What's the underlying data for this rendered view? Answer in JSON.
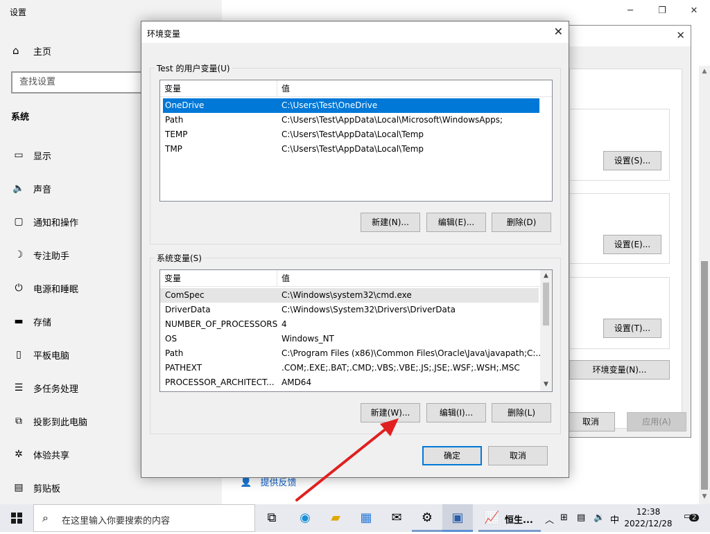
{
  "settings": {
    "title": "设置",
    "home": "主页",
    "search_placeholder": "查找设置",
    "section": "系统",
    "nav": [
      {
        "label": "显示",
        "icon": "monitor-icon"
      },
      {
        "label": "声音",
        "icon": "speaker-icon"
      },
      {
        "label": "通知和操作",
        "icon": "notification-icon"
      },
      {
        "label": "专注助手",
        "icon": "moon-icon"
      },
      {
        "label": "电源和睡眠",
        "icon": "power-icon"
      },
      {
        "label": "存储",
        "icon": "storage-icon"
      },
      {
        "label": "平板电脑",
        "icon": "tablet-icon"
      },
      {
        "label": "多任务处理",
        "icon": "multitask-icon"
      },
      {
        "label": "投影到此电脑",
        "icon": "project-icon"
      },
      {
        "label": "体验共享",
        "icon": "share-icon"
      },
      {
        "label": "剪贴板",
        "icon": "clipboard-icon"
      }
    ],
    "feedback": "提供反馈"
  },
  "sysprop": {
    "btn_perf": "设置(S)...",
    "btn_profile": "设置(E)...",
    "btn_startup": "设置(T)...",
    "btn_env": "环境变量(N)...",
    "btn_cancel": "取消",
    "btn_apply": "应用(A)"
  },
  "env_dialog": {
    "title": "环境变量",
    "user_group": "Test 的用户变量(U)",
    "system_group": "系统变量(S)",
    "col_var": "变量",
    "col_val": "值",
    "user_vars": [
      {
        "name": "OneDrive",
        "value": "C:\\Users\\Test\\OneDrive"
      },
      {
        "name": "Path",
        "value": "C:\\Users\\Test\\AppData\\Local\\Microsoft\\WindowsApps;"
      },
      {
        "name": "TEMP",
        "value": "C:\\Users\\Test\\AppData\\Local\\Temp"
      },
      {
        "name": "TMP",
        "value": "C:\\Users\\Test\\AppData\\Local\\Temp"
      }
    ],
    "system_vars": [
      {
        "name": "ComSpec",
        "value": "C:\\Windows\\system32\\cmd.exe"
      },
      {
        "name": "DriverData",
        "value": "C:\\Windows\\System32\\Drivers\\DriverData"
      },
      {
        "name": "NUMBER_OF_PROCESSORS",
        "value": "4"
      },
      {
        "name": "OS",
        "value": "Windows_NT"
      },
      {
        "name": "Path",
        "value": "C:\\Program Files (x86)\\Common Files\\Oracle\\Java\\javapath;C:..."
      },
      {
        "name": "PATHEXT",
        "value": ".COM;.EXE;.BAT;.CMD;.VBS;.VBE;.JS;.JSE;.WSF;.WSH;.MSC"
      },
      {
        "name": "PROCESSOR_ARCHITECT...",
        "value": "AMD64"
      }
    ],
    "user_new": "新建(N)...",
    "user_edit": "编辑(E)...",
    "user_delete": "删除(D)",
    "sys_new": "新建(W)...",
    "sys_edit": "编辑(I)...",
    "sys_delete": "删除(L)",
    "ok": "确定",
    "cancel": "取消"
  },
  "taskbar": {
    "search_placeholder": "在这里输入你要搜索的内容",
    "app_label": "恒生...",
    "ime": "中",
    "time": "12:38",
    "date": "2022/12/28",
    "notification_count": "2"
  },
  "colors": {
    "selection": "#0078d7",
    "arrow": "#e02020"
  }
}
